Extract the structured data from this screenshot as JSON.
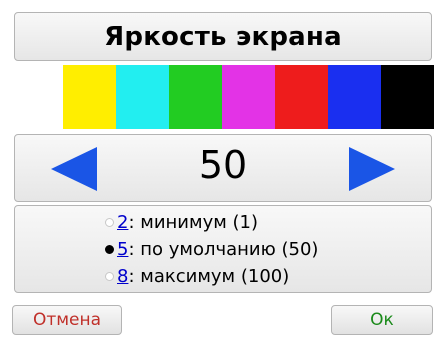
{
  "dialog": {
    "title": "Яркость экрана"
  },
  "swatches": [
    {
      "name": "white",
      "color": "#ffffff"
    },
    {
      "name": "yellow",
      "color": "#ffee00"
    },
    {
      "name": "cyan",
      "color": "#22eef0"
    },
    {
      "name": "green",
      "color": "#22cc22"
    },
    {
      "name": "magenta",
      "color": "#e333e6"
    },
    {
      "name": "red",
      "color": "#ee1c1c"
    },
    {
      "name": "blue",
      "color": "#1a2ff0"
    },
    {
      "name": "black",
      "color": "#000000"
    }
  ],
  "brightness": {
    "value": "50",
    "decrease_icon": "left-arrow-icon",
    "increase_icon": "right-arrow-icon",
    "arrow_color": "#1a55e6"
  },
  "presets": [
    {
      "key": "2",
      "label": ": минимум (1)",
      "selected": false
    },
    {
      "key": "5",
      "label": ": по умолчанию (50)",
      "selected": true
    },
    {
      "key": "8",
      "label": ": максимум (100)",
      "selected": false
    }
  ],
  "buttons": {
    "cancel_label": "Отмена",
    "cancel_color": "#c0302a",
    "ok_label": "Ок",
    "ok_color": "#1a8a1a"
  }
}
